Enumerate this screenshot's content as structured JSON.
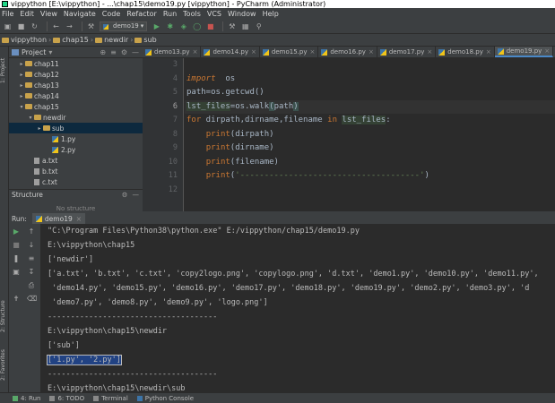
{
  "title": "vippython [E:\\vippython] - ...\\chap15\\demo19.py [vippython] - PyCharm (Administrator)",
  "menu": [
    "File",
    "Edit",
    "View",
    "Navigate",
    "Code",
    "Refactor",
    "Run",
    "Tools",
    "VCS",
    "Window",
    "Help"
  ],
  "run_config": "demo19",
  "breadcrumb": [
    "vippython",
    "chap15",
    "newdir",
    "sub"
  ],
  "project_panel": {
    "title": "Project",
    "tree": [
      {
        "label": "chap11",
        "type": "folder",
        "indent": 1,
        "expanded": false
      },
      {
        "label": "chap12",
        "type": "folder",
        "indent": 1,
        "expanded": false
      },
      {
        "label": "chap13",
        "type": "folder",
        "indent": 1,
        "expanded": false
      },
      {
        "label": "chap14",
        "type": "folder",
        "indent": 1,
        "expanded": false
      },
      {
        "label": "chap15",
        "type": "folder",
        "indent": 1,
        "expanded": true
      },
      {
        "label": "newdir",
        "type": "folder",
        "indent": 2,
        "expanded": true
      },
      {
        "label": "sub",
        "type": "folder",
        "indent": 3,
        "expanded": false,
        "selected": true
      },
      {
        "label": "1.py",
        "type": "py",
        "indent": 4
      },
      {
        "label": "2.py",
        "type": "py",
        "indent": 4
      },
      {
        "label": "a.txt",
        "type": "file",
        "indent": 2
      },
      {
        "label": "b.txt",
        "type": "file",
        "indent": 2
      },
      {
        "label": "c.txt",
        "type": "file",
        "indent": 2
      }
    ]
  },
  "structure_panel": {
    "title": "Structure",
    "empty_text": "No structure"
  },
  "editor_tabs": [
    "demo13.py",
    "demo14.py",
    "demo15.py",
    "demo16.py",
    "demo17.py",
    "demo18.py",
    "demo19.py"
  ],
  "active_tab_index": 6,
  "line_numbers": [
    "3",
    "4",
    "5",
    "6",
    "7",
    "8",
    "9",
    "10",
    "11",
    "12"
  ],
  "current_line_index": 3,
  "run_panel": {
    "label": "Run:",
    "tab": "demo19"
  },
  "console_lines": [
    "\"C:\\Program Files\\Python38\\python.exe\" E:/vippython/chap15/demo19.py",
    "E:\\vippython\\chap15",
    "['newdir']",
    "['a.txt', 'b.txt', 'c.txt', 'copy2logo.png', 'copylogo.png', 'd.txt', 'demo1.py', 'demo10.py', 'demo11.py',",
    " 'demo14.py', 'demo15.py', 'demo16.py', 'demo17.py', 'demo18.py', 'demo19.py', 'demo2.py', 'demo3.py', 'd",
    " 'demo7.py', 'demo8.py', 'demo9.py', 'logo.png']",
    "-------------------------------------",
    "E:\\vippython\\chap15\\newdir",
    "['sub']",
    "['1.py', '2.py']",
    "-------------------------------------",
    "E:\\vippython\\chap15\\newdir\\sub"
  ],
  "selected_console_line": 9,
  "bottom_tabs": [
    "4: Run",
    "6: TODO",
    "Terminal",
    "Python Console"
  ],
  "left_strip_tabs": [
    "1: Project",
    "2: Structure",
    "2: Favorites"
  ]
}
